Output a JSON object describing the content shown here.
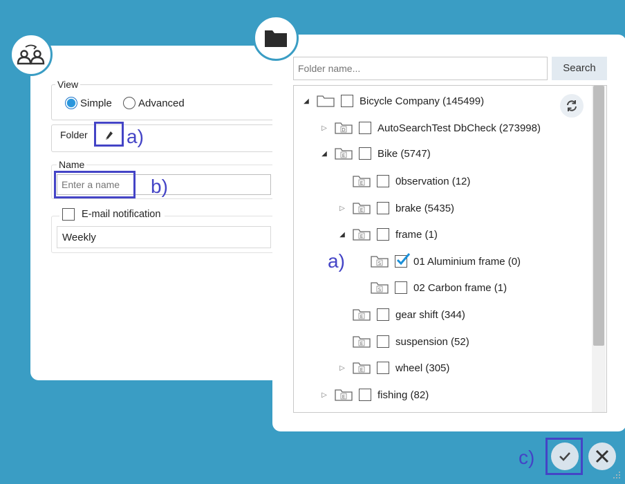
{
  "left_dialog": {
    "view_legend": "View",
    "radio_simple": "Simple",
    "radio_advanced": "Advanced",
    "folder_label": "Folder",
    "name_legend": "Name",
    "name_placeholder": "Enter a name",
    "email_label": "E-mail notification",
    "frequency_value": "Weekly"
  },
  "right_dialog": {
    "search_placeholder": "Folder name...",
    "search_button": "Search",
    "tree": [
      {
        "label": "Bicycle Company (145499)",
        "expander": "expanded",
        "letter": "",
        "checked": false
      },
      {
        "label": "AutoSearchTest DbCheck (273998)",
        "expander": "collapsed",
        "letter": "D",
        "checked": false
      },
      {
        "label": "Bike (5747)",
        "expander": "expanded",
        "letter": "E",
        "checked": false
      },
      {
        "label": "0bservation (12)",
        "expander": "none",
        "letter": "E",
        "checked": false
      },
      {
        "label": "brake (5435)",
        "expander": "collapsed",
        "letter": "E",
        "checked": false
      },
      {
        "label": "frame (1)",
        "expander": "expanded",
        "letter": "E",
        "checked": false
      },
      {
        "label": "01 Aluminium frame (0)",
        "expander": "none",
        "letter": "S",
        "checked": true
      },
      {
        "label": "02 Carbon frame (1)",
        "expander": "none",
        "letter": "S",
        "checked": false
      },
      {
        "label": "gear shift (344)",
        "expander": "none",
        "letter": "E",
        "checked": false
      },
      {
        "label": "suspension (52)",
        "expander": "none",
        "letter": "E",
        "checked": false
      },
      {
        "label": "wheel (305)",
        "expander": "collapsed",
        "letter": "E",
        "checked": false
      },
      {
        "label": "fishing (82)",
        "expander": "collapsed",
        "letter": "E",
        "checked": false
      }
    ]
  },
  "annotations": {
    "folder_edit": "a)",
    "name_field": "b)",
    "tree_check": "a)",
    "ok_button": "c)"
  },
  "colors": {
    "background": "#3a9dc4",
    "annotation": "#4444c6",
    "radio_selected": "#2a95dc",
    "check_mark": "#1a8fd8"
  }
}
